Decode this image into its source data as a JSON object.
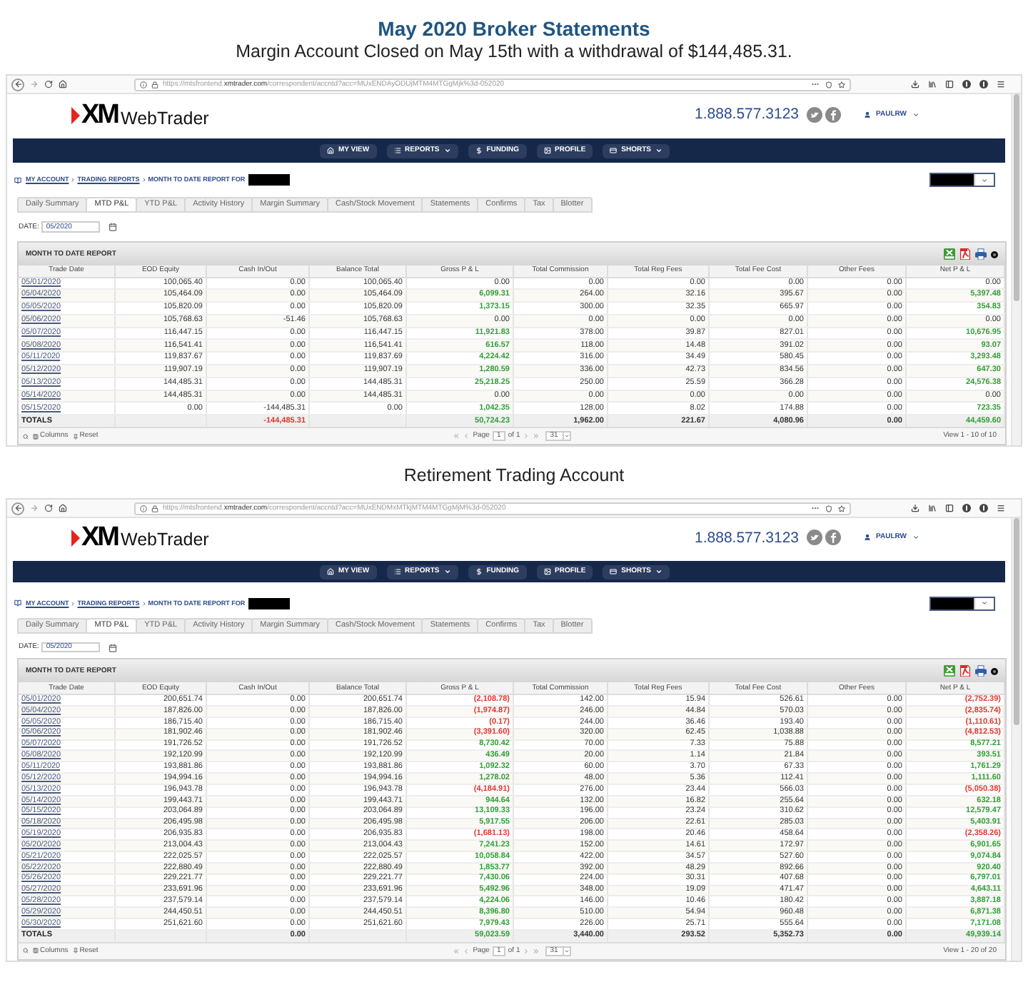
{
  "title": "May 2020 Broker Statements",
  "sections": [
    {
      "caption": "Margin Account Closed on May 15th with a withdrawal of $144,485.31.",
      "browser": {
        "url_start": "https://mtsfrontend.",
        "url_domain": "xmtrader.com",
        "url_end": "/correspondent/accntd?acc=MUxENDAyODUjMTM4MTGgMjk%3d-052020"
      },
      "site": {
        "logo_mark": "XM",
        "logo_text": "WebTrader",
        "phone": "1.888.577.3123",
        "user": "PAULRW"
      },
      "nav": [
        {
          "label": "MY VIEW",
          "dropdown": false
        },
        {
          "label": "REPORTS",
          "dropdown": true
        },
        {
          "label": "FUNDING",
          "dropdown": false
        },
        {
          "label": "PROFILE",
          "dropdown": false
        },
        {
          "label": "SHORTS",
          "dropdown": true
        }
      ],
      "breadcrumbs": [
        {
          "label": "MY ACCOUNT",
          "link": true
        },
        {
          "label": "TRADING REPORTS",
          "link": true
        },
        {
          "label": "MONTH TO DATE REPORT FOR",
          "link": false
        }
      ],
      "tabs": [
        {
          "label": "Daily Summary",
          "selected": false
        },
        {
          "label": "MTD P&L",
          "selected": true
        },
        {
          "label": "YTD P&L",
          "selected": false
        },
        {
          "label": "Activity History",
          "selected": false
        },
        {
          "label": "Margin Summary",
          "selected": false
        },
        {
          "label": "Cash/Stock Movement",
          "selected": false
        },
        {
          "label": "Statements",
          "selected": false
        },
        {
          "label": "Confirms",
          "selected": false
        },
        {
          "label": "Tax",
          "selected": false
        },
        {
          "label": "Blotter",
          "selected": false
        }
      ],
      "date": {
        "label": "DATE:",
        "value": "05/2020"
      },
      "report": {
        "title": "MONTH TO DATE REPORT",
        "columns": [
          "Trade Date",
          "EOD Equity",
          "Cash In/Out",
          "Balance Total",
          "Gross P & L",
          "Total Commission",
          "Total Reg Fees",
          "Total Fee Cost",
          "Other Fees",
          "Net P & L"
        ],
        "rows": [
          [
            "05/01/2020",
            "100,065.40",
            "0.00",
            "100,065.40",
            "0.00",
            "0.00",
            "0.00",
            "0.00",
            "0.00",
            "0.00"
          ],
          [
            "05/04/2020",
            "105,464.09",
            "0.00",
            "105,464.09",
            {
              "text": "6,099.31",
              "color": "#2f9e34"
            },
            "264.00",
            "32.16",
            "395.67",
            "0.00",
            {
              "text": "5,397.48",
              "color": "#2f9e34"
            }
          ],
          [
            "05/05/2020",
            "105,820.09",
            "0.00",
            "105,820.09",
            {
              "text": "1,373.15",
              "color": "#2f9e34"
            },
            "300.00",
            "32.35",
            "665.97",
            "0.00",
            {
              "text": "354.83",
              "color": "#2f9e34"
            }
          ],
          [
            "05/06/2020",
            "105,768.63",
            "-51.46",
            "105,768.63",
            "0.00",
            "0.00",
            "0.00",
            "0.00",
            "0.00",
            "0.00"
          ],
          [
            "05/07/2020",
            "116,447.15",
            "0.00",
            "116,447.15",
            {
              "text": "11,921.83",
              "color": "#2f9e34"
            },
            "378.00",
            "39.87",
            "827.01",
            "0.00",
            {
              "text": "10,676.95",
              "color": "#2f9e34"
            }
          ],
          [
            "05/08/2020",
            "116,541.41",
            "0.00",
            "116,541.41",
            {
              "text": "616.57",
              "color": "#2f9e34"
            },
            "118.00",
            "14.48",
            "391.02",
            "0.00",
            {
              "text": "93.07",
              "color": "#2f9e34"
            }
          ],
          [
            "05/11/2020",
            "119,837.67",
            "0.00",
            "119,837.69",
            {
              "text": "4,224.42",
              "color": "#2f9e34"
            },
            "316.00",
            "34.49",
            "580.45",
            "0.00",
            {
              "text": "3,293.48",
              "color": "#2f9e34"
            }
          ],
          [
            "05/12/2020",
            "119,907.19",
            "0.00",
            "119,907.19",
            {
              "text": "1,280.59",
              "color": "#2f9e34"
            },
            "336.00",
            "42.73",
            "834.56",
            "0.00",
            {
              "text": "647.30",
              "color": "#2f9e34"
            }
          ],
          [
            "05/13/2020",
            "144,485.31",
            "0.00",
            "144,485.31",
            {
              "text": "25,218.25",
              "color": "#2f9e34"
            },
            "250.00",
            "25.59",
            "366.28",
            "0.00",
            {
              "text": "24,576.38",
              "color": "#2f9e34"
            }
          ],
          [
            "05/14/2020",
            "144,485.31",
            "0.00",
            "144,485.31",
            "0.00",
            "0.00",
            "0.00",
            "0.00",
            "0.00",
            "0.00"
          ],
          [
            "05/15/2020",
            "0.00",
            "-144,485.31",
            "0.00",
            {
              "text": "1,042.35",
              "color": "#2f9e34"
            },
            "128.00",
            "8.02",
            "174.88",
            "0.00",
            {
              "text": "723.35",
              "color": "#2f9e34"
            }
          ]
        ],
        "totals": {
          "label": "TOTALS",
          "cells": [
            null,
            {
              "text": "-144,485.31",
              "color": "#e3342f"
            },
            null,
            {
              "text": "50,724.23",
              "color": "#2f9e34"
            },
            "1,962.00",
            "221.67",
            "4,080.96",
            "0.00",
            {
              "text": "44,459.60",
              "color": "#2f9e34"
            }
          ]
        }
      },
      "pager": {
        "columns_label": "Columns",
        "reset_label": "Reset",
        "page_label": "Page",
        "page": "1",
        "page_count": "of 1",
        "page_size": "31",
        "view": "View 1 - 10 of 10"
      }
    },
    {
      "caption": "Retirement Trading Account",
      "browser": {
        "url_start": "https://mtsfrontend.",
        "url_domain": "xmtrader.com",
        "url_end": "/correspondent/accntd?acc=MUxENDMxMTkjMTM4MTGgMjM%3d-052020"
      },
      "site": {
        "logo_mark": "XM",
        "logo_text": "WebTrader",
        "phone": "1.888.577.3123",
        "user": "PAULRW"
      },
      "nav": [
        {
          "label": "MY VIEW",
          "dropdown": false
        },
        {
          "label": "REPORTS",
          "dropdown": true
        },
        {
          "label": "FUNDING",
          "dropdown": false
        },
        {
          "label": "PROFILE",
          "dropdown": false
        },
        {
          "label": "SHORTS",
          "dropdown": true
        }
      ],
      "breadcrumbs": [
        {
          "label": "MY ACCOUNT",
          "link": true
        },
        {
          "label": "TRADING REPORTS",
          "link": true
        },
        {
          "label": "MONTH TO DATE REPORT FOR",
          "link": false
        }
      ],
      "tabs": [
        {
          "label": "Daily Summary",
          "selected": false
        },
        {
          "label": "MTD P&L",
          "selected": true
        },
        {
          "label": "YTD P&L",
          "selected": false
        },
        {
          "label": "Activity History",
          "selected": false
        },
        {
          "label": "Margin Summary",
          "selected": false
        },
        {
          "label": "Cash/Stock Movement",
          "selected": false
        },
        {
          "label": "Statements",
          "selected": false
        },
        {
          "label": "Confirms",
          "selected": false
        },
        {
          "label": "Tax",
          "selected": false
        },
        {
          "label": "Blotter",
          "selected": false
        }
      ],
      "date": {
        "label": "DATE:",
        "value": "05/2020"
      },
      "report": {
        "title": "MONTH TO DATE REPORT",
        "columns": [
          "Trade Date",
          "EOD Equity",
          "Cash In/Out",
          "Balance Total",
          "Gross P & L",
          "Total Commission",
          "Total Reg Fees",
          "Total Fee Cost",
          "Other Fees",
          "Net P & L"
        ],
        "rows": [
          [
            "05/01/2020",
            "200,651.74",
            "0.00",
            "200,651.74",
            {
              "text": "(2,108.78)",
              "color": "#e3342f"
            },
            "142.00",
            "15.94",
            "526.61",
            "0.00",
            {
              "text": "(2,752.39)",
              "color": "#e3342f"
            }
          ],
          [
            "05/04/2020",
            "187,826.00",
            "0.00",
            "187,826.00",
            {
              "text": "(1,974.87)",
              "color": "#e3342f"
            },
            "246.00",
            "44.84",
            "570.03",
            "0.00",
            {
              "text": "(2,835.74)",
              "color": "#e3342f"
            }
          ],
          [
            "05/05/2020",
            "186,715.40",
            "0.00",
            "186,715.40",
            {
              "text": "(0.17)",
              "color": "#e3342f"
            },
            "244.00",
            "36.46",
            "193.40",
            "0.00",
            {
              "text": "(1,110.61)",
              "color": "#e3342f"
            }
          ],
          [
            "05/06/2020",
            "181,902.46",
            "0.00",
            "181,902.46",
            {
              "text": "(3,391.60)",
              "color": "#e3342f"
            },
            "320.00",
            "62.45",
            "1,038.88",
            "0.00",
            {
              "text": "(4,812.53)",
              "color": "#e3342f"
            }
          ],
          [
            "05/07/2020",
            "191,726.52",
            "0.00",
            "191,726.52",
            {
              "text": "8,730.42",
              "color": "#2f9e34"
            },
            "70.00",
            "7.33",
            "75.88",
            "0.00",
            {
              "text": "8,577.21",
              "color": "#2f9e34"
            }
          ],
          [
            "05/08/2020",
            "192,120.99",
            "0.00",
            "192,120.99",
            {
              "text": "436.49",
              "color": "#2f9e34"
            },
            "20.00",
            "1.14",
            "21.84",
            "0.00",
            {
              "text": "393.51",
              "color": "#2f9e34"
            }
          ],
          [
            "05/11/2020",
            "193,881.86",
            "0.00",
            "193,881.86",
            {
              "text": "1,092.32",
              "color": "#2f9e34"
            },
            "60.00",
            "3.70",
            "67.33",
            "0.00",
            {
              "text": "1,761.29",
              "color": "#2f9e34"
            }
          ],
          [
            "05/12/2020",
            "194,994.16",
            "0.00",
            "194,994.16",
            {
              "text": "1,278.02",
              "color": "#2f9e34"
            },
            "48.00",
            "5.36",
            "112.41",
            "0.00",
            {
              "text": "1,111.60",
              "color": "#2f9e34"
            }
          ],
          [
            "05/13/2020",
            "196,943.78",
            "0.00",
            "196,943.78",
            {
              "text": "(4,184.91)",
              "color": "#e3342f"
            },
            "276.00",
            "23.44",
            "566.03",
            "0.00",
            {
              "text": "(5,050.38)",
              "color": "#e3342f"
            }
          ],
          [
            "05/14/2020",
            "199,443.71",
            "0.00",
            "199,443.71",
            {
              "text": "944.64",
              "color": "#2f9e34"
            },
            "132.00",
            "16.82",
            "255.64",
            "0.00",
            {
              "text": "632.18",
              "color": "#2f9e34"
            }
          ],
          [
            "05/15/2020",
            "203,064.89",
            "0.00",
            "203,064.89",
            {
              "text": "13,109.33",
              "color": "#2f9e34"
            },
            "196.00",
            "23.24",
            "310.62",
            "0.00",
            {
              "text": "12,579.47",
              "color": "#2f9e34"
            }
          ],
          [
            "05/18/2020",
            "206,495.98",
            "0.00",
            "206,495.98",
            {
              "text": "5,917.55",
              "color": "#2f9e34"
            },
            "206.00",
            "22.61",
            "285.03",
            "0.00",
            {
              "text": "5,403.91",
              "color": "#2f9e34"
            }
          ],
          [
            "05/19/2020",
            "206,935.83",
            "0.00",
            "206,935.83",
            {
              "text": "(1,681.13)",
              "color": "#e3342f"
            },
            "198.00",
            "20.46",
            "458.64",
            "0.00",
            {
              "text": "(2,358.26)",
              "color": "#e3342f"
            }
          ],
          [
            "05/20/2020",
            "213,004.43",
            "0.00",
            "213,004.43",
            {
              "text": "7,241.23",
              "color": "#2f9e34"
            },
            "152.00",
            "14.61",
            "172.97",
            "0.00",
            {
              "text": "6,901.65",
              "color": "#2f9e34"
            }
          ],
          [
            "05/21/2020",
            "222,025.57",
            "0.00",
            "222,025.57",
            {
              "text": "10,058.84",
              "color": "#2f9e34"
            },
            "422.00",
            "34.57",
            "527.60",
            "0.00",
            {
              "text": "9,074.84",
              "color": "#2f9e34"
            }
          ],
          [
            "05/22/2020",
            "222,880.49",
            "0.00",
            "222,880.49",
            {
              "text": "1,853.77",
              "color": "#2f9e34"
            },
            "392.00",
            "48.29",
            "892.66",
            "0.00",
            {
              "text": "920.40",
              "color": "#2f9e34"
            }
          ],
          [
            "05/26/2020",
            "229,221.77",
            "0.00",
            "229,221.77",
            {
              "text": "7,430.06",
              "color": "#2f9e34"
            },
            "224.00",
            "30.31",
            "407.68",
            "0.00",
            {
              "text": "6,797.01",
              "color": "#2f9e34"
            }
          ],
          [
            "05/27/2020",
            "233,691.96",
            "0.00",
            "233,691.96",
            {
              "text": "5,492.96",
              "color": "#2f9e34"
            },
            "348.00",
            "19.09",
            "471.47",
            "0.00",
            {
              "text": "4,643.11",
              "color": "#2f9e34"
            }
          ],
          [
            "05/28/2020",
            "237,579.14",
            "0.00",
            "237,579.14",
            {
              "text": "4,224.06",
              "color": "#2f9e34"
            },
            "146.00",
            "10.46",
            "180.42",
            "0.00",
            {
              "text": "3,887.18",
              "color": "#2f9e34"
            }
          ],
          [
            "05/29/2020",
            "244,450.51",
            "0.00",
            "244,450.51",
            {
              "text": "8,396.80",
              "color": "#2f9e34"
            },
            "510.00",
            "54.94",
            "960.48",
            "0.00",
            {
              "text": "6,871.38",
              "color": "#2f9e34"
            }
          ],
          [
            "05/30/2020",
            "251,621.60",
            "0.00",
            "251,621.60",
            {
              "text": "7,979.43",
              "color": "#2f9e34"
            },
            "226.00",
            "25.71",
            "555.64",
            "0.00",
            {
              "text": "7,171.08",
              "color": "#2f9e34"
            }
          ]
        ],
        "totals": {
          "label": "TOTALS",
          "cells": [
            null,
            "0.00",
            null,
            {
              "text": "59,023.59",
              "color": "#2f9e34"
            },
            "3,440.00",
            "293.52",
            "5,352.73",
            "0.00",
            {
              "text": "49,939.14",
              "color": "#2f9e34"
            }
          ]
        }
      },
      "pager": {
        "columns_label": "Columns",
        "reset_label": "Reset",
        "page_label": "Page",
        "page": "1",
        "page_count": "of 1",
        "page_size": "31",
        "view": "View 1 - 20 of 20"
      }
    }
  ]
}
